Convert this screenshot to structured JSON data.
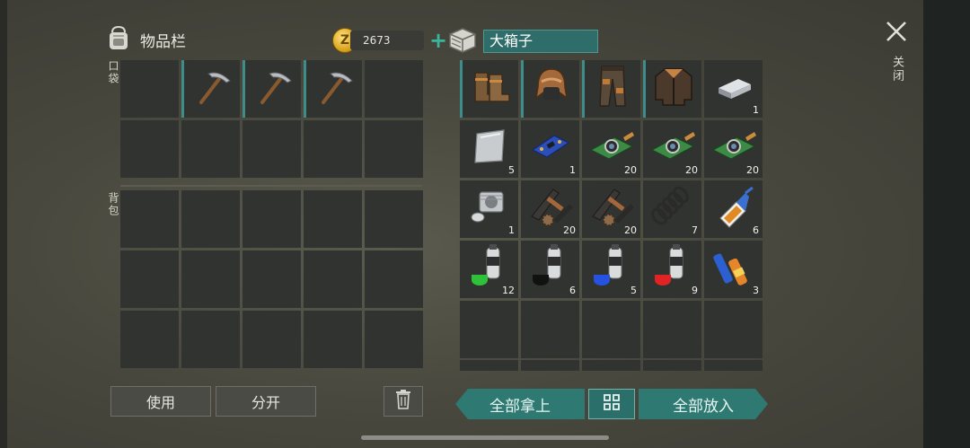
{
  "inventory": {
    "title": "物品栏",
    "icon": "backpack-icon",
    "coins": "2673",
    "add_coins_icon": "plus-icon",
    "pocket_label": "口袋",
    "backpack_label": "背包",
    "pocket_items": [
      "pickaxe-icon",
      "pickaxe-icon",
      "pickaxe-icon"
    ],
    "use_button": "使用",
    "split_button": "分开",
    "trash_icon": "trash-icon"
  },
  "container": {
    "icon": "crate-icon",
    "name": "大箱子",
    "items": [
      {
        "icon": "boots-icon",
        "qty": ""
      },
      {
        "icon": "fur-hat-icon",
        "qty": ""
      },
      {
        "icon": "pants-icon",
        "qty": ""
      },
      {
        "icon": "jacket-icon",
        "qty": ""
      },
      {
        "icon": "iron-ingot-icon",
        "qty": "1"
      },
      {
        "icon": "metal-plate-icon",
        "qty": "5"
      },
      {
        "icon": "circuit-board-icon",
        "qty": "1"
      },
      {
        "icon": "camera-module-icon",
        "qty": "20"
      },
      {
        "icon": "camera-module-icon",
        "qty": "20"
      },
      {
        "icon": "camera-module-icon",
        "qty": "20"
      },
      {
        "icon": "engine-cylinder-icon",
        "qty": "1"
      },
      {
        "icon": "gear-parts-icon",
        "qty": "20"
      },
      {
        "icon": "gear-parts-icon",
        "qty": "20"
      },
      {
        "icon": "spring-icon",
        "qty": "7"
      },
      {
        "icon": "glue-icon",
        "qty": "6"
      },
      {
        "icon": "spray-paint-green-icon",
        "qty": "12"
      },
      {
        "icon": "spray-paint-black-icon",
        "qty": "6"
      },
      {
        "icon": "spray-paint-blue-icon",
        "qty": "5"
      },
      {
        "icon": "spray-paint-red-icon",
        "qty": "9"
      },
      {
        "icon": "batteries-icon",
        "qty": "3"
      }
    ],
    "take_all_button": "全部拿上",
    "sort_icon": "grid-sort-icon",
    "put_all_button": "全部放入"
  },
  "close_label": "关闭",
  "colors": {
    "accent": "#2e7a73",
    "coin": "#e3ad28",
    "plus": "#39b59c"
  }
}
